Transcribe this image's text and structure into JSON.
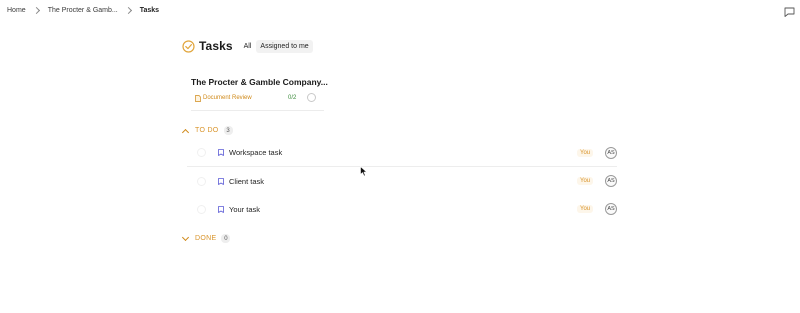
{
  "breadcrumb": {
    "home": "Home",
    "client": "The Procter & Gamb...",
    "current": "Tasks"
  },
  "header": {
    "title": "Tasks",
    "filters": {
      "all": "All",
      "assigned": "Assigned to me"
    }
  },
  "client_card": {
    "name": "The Procter & Gamble Company...",
    "doc_label": "Document Review",
    "doc_count": "0/2"
  },
  "sections": {
    "todo": {
      "label": "TO DO",
      "count": "3"
    },
    "done": {
      "label": "DONE",
      "count": "0"
    }
  },
  "tasks": [
    {
      "name": "Workspace task",
      "assignee_chip": "You",
      "avatar": "AS"
    },
    {
      "name": "Client task",
      "assignee_chip": "You",
      "avatar": "AS"
    },
    {
      "name": "Your task",
      "assignee_chip": "You",
      "avatar": "AS"
    }
  ],
  "colors": {
    "accent": "#d9942b",
    "progress": "#3b8b3b",
    "task_icon": "#5b5bd6"
  },
  "icons": {
    "title": "check-circle-icon",
    "comment": "comment-icon",
    "doc": "document-icon",
    "task": "bookmark-icon"
  }
}
